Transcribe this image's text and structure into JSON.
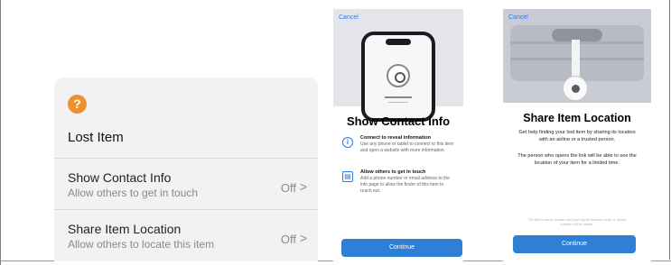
{
  "lost_item_panel": {
    "help_icon_glyph": "?",
    "title": "Lost Item",
    "rows": [
      {
        "title": "Show Contact Info",
        "subtitle": "Allow others to get in touch",
        "value": "Off",
        "chevron": ">"
      },
      {
        "title": "Share Item Location",
        "subtitle": "Allow others to locate this item",
        "value": "Off",
        "chevron": ">"
      }
    ]
  },
  "contact_sheet": {
    "cancel_label": "Cancel",
    "title": "Show Contact Info",
    "items": [
      {
        "icon": "info-icon",
        "icon_glyph": "i",
        "heading": "Connect to reveal information",
        "body": "Use any phone or tablet to connect to this item and open a website with more information."
      },
      {
        "icon": "contact-card-icon",
        "icon_glyph": "▤",
        "heading": "Allow others to get in touch",
        "body": "Add a phone number or email address to the info page to allow the finder of this item to reach out."
      }
    ],
    "continue_label": "Continue"
  },
  "location_sheet": {
    "cancel_label": "Cancel",
    "title": "Share Item Location",
    "paragraph_1": "Get help finding your lost item by sharing its location with an airline or a trusted person.",
    "paragraph_2": "The person who opens the link will be able to see the location of your item for a limited time.",
    "fine_print": "The item's serial number and your Apple Account email or phone number will be visible.",
    "continue_label": "Continue"
  },
  "colors": {
    "accent_blue": "#2f7fd5",
    "help_orange": "#f0902b"
  }
}
